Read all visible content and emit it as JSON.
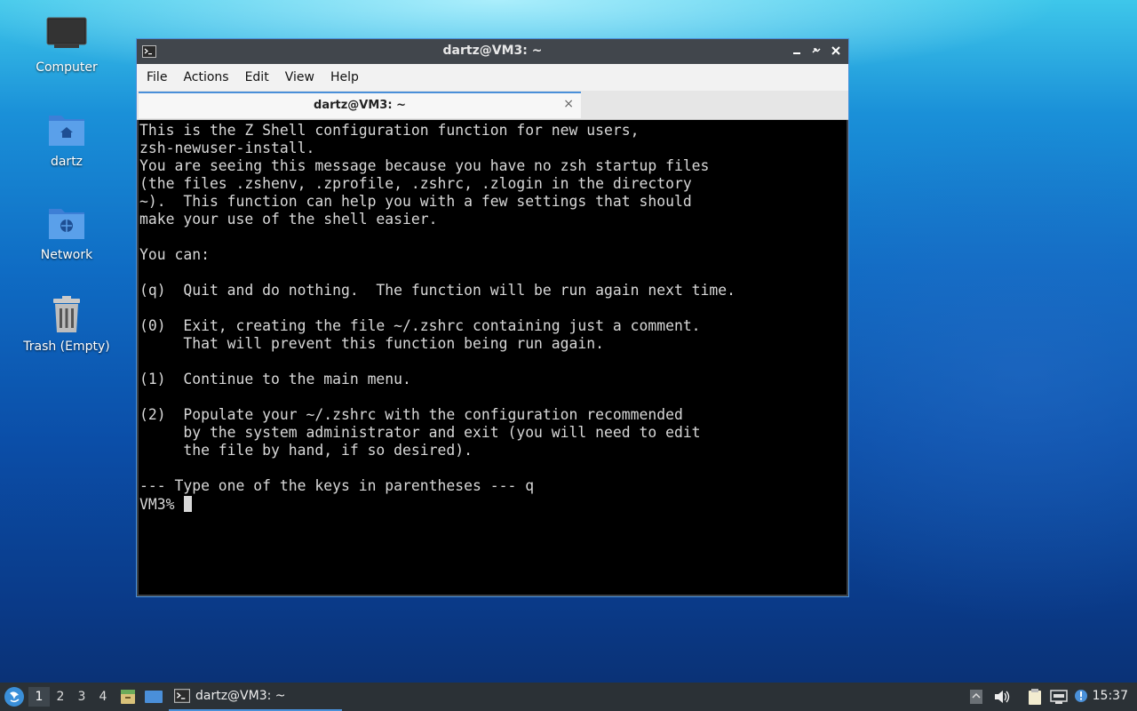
{
  "desktop": {
    "icons": [
      {
        "label": "Computer",
        "icon": "computer-icon"
      },
      {
        "label": "dartz",
        "icon": "home-folder-icon"
      },
      {
        "label": "Network",
        "icon": "network-folder-icon"
      },
      {
        "label": "Trash (Empty)",
        "icon": "trash-icon"
      }
    ]
  },
  "window": {
    "title": "dartz@VM3: ~",
    "controls": [
      "minimize",
      "maximize",
      "close"
    ],
    "menu": [
      "File",
      "Actions",
      "Edit",
      "View",
      "Help"
    ],
    "tab": {
      "label": "dartz@VM3: ~",
      "close": "×"
    }
  },
  "terminal": {
    "output": "This is the Z Shell configuration function for new users,\nzsh-newuser-install.\nYou are seeing this message because you have no zsh startup files\n(the files .zshenv, .zprofile, .zshrc, .zlogin in the directory\n~).  This function can help you with a few settings that should\nmake your use of the shell easier.\n\nYou can:\n\n(q)  Quit and do nothing.  The function will be run again next time.\n\n(0)  Exit, creating the file ~/.zshrc containing just a comment.\n     That will prevent this function being run again.\n\n(1)  Continue to the main menu.\n\n(2)  Populate your ~/.zshrc with the configuration recommended\n     by the system administrator and exit (you will need to edit\n     the file by hand, if so desired).\n\n--- Type one of the keys in parentheses --- q",
    "prompt": "VM3% "
  },
  "taskbar": {
    "workspaces": [
      "1",
      "2",
      "3",
      "4"
    ],
    "active_workspace": "1",
    "task_label": "dartz@VM3: ~",
    "clock": "15:37"
  },
  "colors": {
    "accent": "#4a90d9",
    "terminal_bg": "#000000",
    "terminal_fg": "#d8d8d8",
    "taskbar_bg": "#2b3136"
  }
}
